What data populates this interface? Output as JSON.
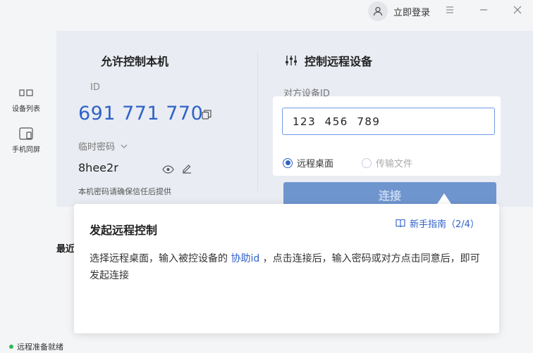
{
  "titlebar": {
    "login_label": "立即登录",
    "icons": [
      "user-icon",
      "menu-icon",
      "minimize-icon",
      "close-icon"
    ]
  },
  "rail": {
    "items": [
      {
        "label": "设备列表",
        "icon": "device-list-icon"
      },
      {
        "label": "手机同屏",
        "icon": "phone-mirror-icon"
      }
    ]
  },
  "allow": {
    "title": "允许控制本机",
    "id_label": "ID",
    "device_id": "691 771 770",
    "password_label": "临时密码",
    "password": "8hee2r",
    "hint": "本机密码请确保信任后提供"
  },
  "control": {
    "title": "控制远程设备",
    "peer_label": "对方设备ID",
    "peer_value": "123  456  789",
    "options": [
      {
        "label": "远程桌面",
        "selected": true
      },
      {
        "label": "传输文件",
        "selected": false
      }
    ],
    "connect_label": "连接"
  },
  "recent": {
    "title_partial": "最近"
  },
  "guide": {
    "title": "发起远程控制",
    "link": "新手指南（2/4）",
    "body_before": "选择远程桌面，输入被控设备的 ",
    "body_highlight": "协助id",
    "body_after": " ，点击连接后，输入密码或对方点击同意后，即可发起连接"
  },
  "status": {
    "text": "远程准备就绪"
  },
  "colors": {
    "accent": "#2f62c8",
    "ready": "#2fb85a",
    "input_border": "#6e9be6"
  }
}
